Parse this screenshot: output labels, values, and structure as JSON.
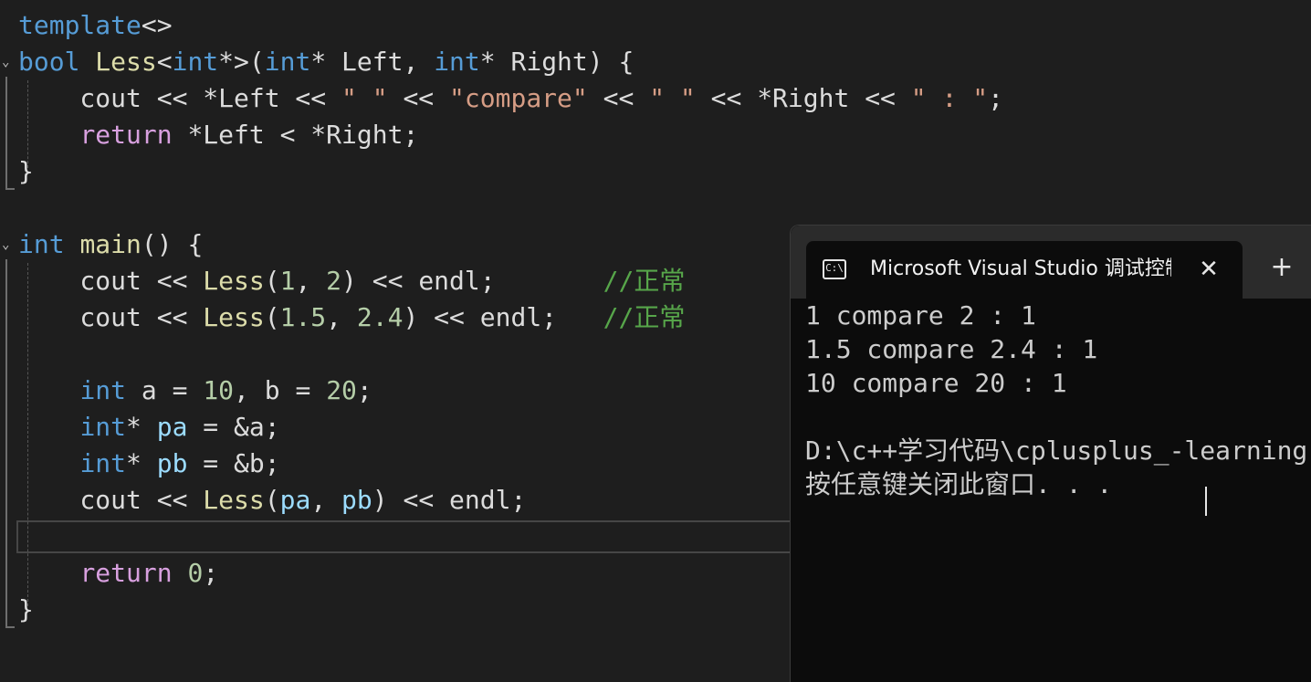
{
  "editor": {
    "lines": [
      [
        {
          "t": "template",
          "c": "kw"
        },
        {
          "t": "<>",
          "c": "op"
        }
      ],
      [
        {
          "t": "bool",
          "c": "kw"
        },
        {
          "t": " ",
          "c": "op"
        },
        {
          "t": "Less",
          "c": "fn"
        },
        {
          "t": "<",
          "c": "op"
        },
        {
          "t": "int",
          "c": "kw"
        },
        {
          "t": "*>(",
          "c": "op"
        },
        {
          "t": "int",
          "c": "kw"
        },
        {
          "t": "* Left, ",
          "c": "op"
        },
        {
          "t": "int",
          "c": "kw"
        },
        {
          "t": "* Right) {",
          "c": "op"
        }
      ],
      [
        {
          "t": "    cout << *Left << ",
          "c": "op"
        },
        {
          "t": "\" \"",
          "c": "str"
        },
        {
          "t": " << ",
          "c": "op"
        },
        {
          "t": "\"compare\"",
          "c": "str"
        },
        {
          "t": " << ",
          "c": "op"
        },
        {
          "t": "\" \"",
          "c": "str"
        },
        {
          "t": " << *Right << ",
          "c": "op"
        },
        {
          "t": "\" : \"",
          "c": "str"
        },
        {
          "t": ";",
          "c": "op"
        }
      ],
      [
        {
          "t": "    ",
          "c": "op"
        },
        {
          "t": "return",
          "c": "ctl"
        },
        {
          "t": " *Left < *Right;",
          "c": "op"
        }
      ],
      [
        {
          "t": "}",
          "c": "op"
        }
      ],
      [],
      [
        {
          "t": "int",
          "c": "kw"
        },
        {
          "t": " ",
          "c": "op"
        },
        {
          "t": "main",
          "c": "fn"
        },
        {
          "t": "() {",
          "c": "op"
        }
      ],
      [
        {
          "t": "    cout << ",
          "c": "op"
        },
        {
          "t": "Less",
          "c": "fn"
        },
        {
          "t": "(",
          "c": "op"
        },
        {
          "t": "1",
          "c": "num"
        },
        {
          "t": ", ",
          "c": "op"
        },
        {
          "t": "2",
          "c": "num"
        },
        {
          "t": ") << endl;       ",
          "c": "op"
        },
        {
          "t": "//正常",
          "c": "cmt"
        }
      ],
      [
        {
          "t": "    cout << ",
          "c": "op"
        },
        {
          "t": "Less",
          "c": "fn"
        },
        {
          "t": "(",
          "c": "op"
        },
        {
          "t": "1.5",
          "c": "num"
        },
        {
          "t": ", ",
          "c": "op"
        },
        {
          "t": "2.4",
          "c": "num"
        },
        {
          "t": ") << endl;   ",
          "c": "op"
        },
        {
          "t": "//正常",
          "c": "cmt"
        }
      ],
      [],
      [
        {
          "t": "    ",
          "c": "op"
        },
        {
          "t": "int",
          "c": "kw"
        },
        {
          "t": " a = ",
          "c": "op"
        },
        {
          "t": "10",
          "c": "num"
        },
        {
          "t": ", b = ",
          "c": "op"
        },
        {
          "t": "20",
          "c": "num"
        },
        {
          "t": ";",
          "c": "op"
        }
      ],
      [
        {
          "t": "    ",
          "c": "op"
        },
        {
          "t": "int",
          "c": "kw"
        },
        {
          "t": "* ",
          "c": "op"
        },
        {
          "t": "pa",
          "c": "var"
        },
        {
          "t": " = &a;",
          "c": "op"
        }
      ],
      [
        {
          "t": "    ",
          "c": "op"
        },
        {
          "t": "int",
          "c": "kw"
        },
        {
          "t": "* ",
          "c": "op"
        },
        {
          "t": "pb",
          "c": "var"
        },
        {
          "t": " = &b;",
          "c": "op"
        }
      ],
      [
        {
          "t": "    cout << ",
          "c": "op"
        },
        {
          "t": "Less",
          "c": "fn"
        },
        {
          "t": "(",
          "c": "op"
        },
        {
          "t": "pa",
          "c": "var"
        },
        {
          "t": ", ",
          "c": "op"
        },
        {
          "t": "pb",
          "c": "var"
        },
        {
          "t": ") << endl;",
          "c": "op"
        }
      ],
      [],
      [
        {
          "t": "    ",
          "c": "op"
        },
        {
          "t": "return",
          "c": "ctl"
        },
        {
          "t": " ",
          "c": "op"
        },
        {
          "t": "0",
          "c": "num"
        },
        {
          "t": ";",
          "c": "op"
        }
      ],
      [
        {
          "t": "}",
          "c": "op"
        }
      ]
    ]
  },
  "console": {
    "tab_title": "Microsoft Visual Studio 调试控制台",
    "tab_icon_text": "C:\\",
    "close_glyph": "✕",
    "new_tab_glyph": "+",
    "output": [
      "1 compare 2 : 1",
      "1.5 compare 2.4 : 1",
      "10 compare 20 : 1",
      "",
      "D:\\c++学习代码\\cplusplus_-learning",
      "按任意键关闭此窗口. . ."
    ]
  }
}
